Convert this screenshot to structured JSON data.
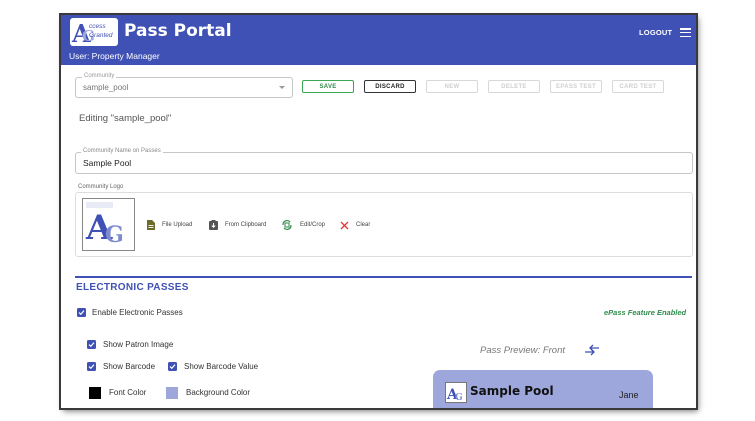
{
  "header": {
    "logo_text_top": "ccess",
    "logo_text_bottom": "Granted",
    "title": "Pass Portal",
    "user": "User: Property Manager",
    "logout_label": "LOGOUT",
    "background": "#3f51b5"
  },
  "community": {
    "label": "Community",
    "value": "sample_pool"
  },
  "toolbar": {
    "save_label": "SAVE",
    "discard_label": "DISCARD",
    "new_label": "NEW",
    "delete_label": "DELETE",
    "epass_test_label": "EPASS TEST",
    "card_test_label": "CARD TEST"
  },
  "editing_text": "Editing \"sample_pool\"",
  "community_name": {
    "label": "Community Name on Passes",
    "value": "Sample Pool"
  },
  "logo_section": {
    "label": "Community Logo",
    "file_upload": "File Upload",
    "from_clipboard": "From Clipboard",
    "edit_crop": "Edit/Crop",
    "clear": "Clear"
  },
  "electronic_passes": {
    "title": "ELECTRONIC PASSES",
    "enable_label": "Enable Electronic Passes",
    "enabled": true,
    "status": "ePass Feature Enabled",
    "show_patron_image": "Show Patron Image",
    "show_barcode": "Show Barcode",
    "show_barcode_value": "Show Barcode Value",
    "font_color_label": "Font Color",
    "background_color_label": "Background Color",
    "font_color": "#000000",
    "background_color": "#9ea7db"
  },
  "preview": {
    "title": "Pass Preview: Front",
    "pass_name": "Sample Pool",
    "patron_name": "Jane"
  },
  "colors": {
    "accent": "#3f51b5",
    "success": "#2e8b4b"
  }
}
